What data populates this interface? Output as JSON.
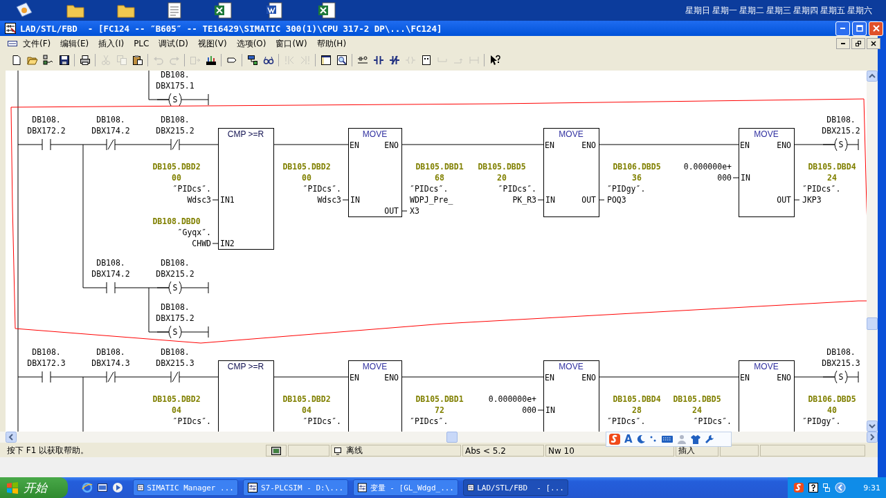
{
  "desktop": {
    "weekdays": [
      "星期日",
      "星期一",
      "星期二",
      "星期三",
      "星期四",
      "星期五",
      "星期六"
    ]
  },
  "window": {
    "title": "LAD/STL/FBD  - [FC124 -- ″B605″ -- TE16429\\SIMATIC 300(1)\\CPU 317-2 DP\\...\\FC124]"
  },
  "menu": [
    "文件(F)",
    "编辑(E)",
    "插入(I)",
    "PLC",
    "调试(D)",
    "视图(V)",
    "选项(O)",
    "窗口(W)",
    "帮助(H)"
  ],
  "toolbar": [
    {
      "kind": "button",
      "disabled": false
    },
    {
      "kind": "button",
      "disabled": false
    },
    {
      "kind": "button",
      "disabled": false
    },
    {
      "kind": "button",
      "disabled": false
    },
    {
      "kind": "separator"
    },
    {
      "kind": "button",
      "disabled": false
    },
    {
      "kind": "separator"
    },
    {
      "kind": "button",
      "disabled": true
    },
    {
      "kind": "button",
      "disabled": true
    },
    {
      "kind": "button",
      "disabled": false
    },
    {
      "kind": "separator"
    },
    {
      "kind": "button",
      "disabled": true
    },
    {
      "kind": "button",
      "disabled": true
    },
    {
      "kind": "separator"
    },
    {
      "kind": "button",
      "disabled": true
    },
    {
      "kind": "button",
      "disabled": false
    },
    {
      "kind": "separator"
    },
    {
      "kind": "button",
      "disabled": false
    },
    {
      "kind": "separator"
    },
    {
      "kind": "button",
      "disabled": false
    },
    {
      "kind": "button",
      "disabled": false
    },
    {
      "kind": "separator"
    },
    {
      "kind": "button",
      "disabled": true
    },
    {
      "kind": "button",
      "disabled": true
    },
    {
      "kind": "separator"
    },
    {
      "kind": "button",
      "disabled": false
    },
    {
      "kind": "button",
      "disabled": false
    },
    {
      "kind": "separator"
    },
    {
      "kind": "button",
      "disabled": false
    },
    {
      "kind": "button",
      "disabled": false
    },
    {
      "kind": "button",
      "disabled": false
    },
    {
      "kind": "button",
      "disabled": true
    },
    {
      "kind": "button",
      "disabled": false
    },
    {
      "kind": "button",
      "disabled": true
    },
    {
      "kind": "button",
      "disabled": true
    },
    {
      "kind": "button",
      "disabled": true
    },
    {
      "kind": "separator"
    },
    {
      "kind": "button",
      "disabled": false
    }
  ],
  "editor": {
    "networks": [
      {
        "kind": "tail",
        "coils": [
          {
            "type": "S",
            "address": [
              "DB108.",
              "DBX175.1"
            ]
          }
        ]
      },
      {
        "kind": "network",
        "contacts": [
          {
            "normally_closed": false,
            "address": [
              "DB108.",
              "DBX172.2"
            ]
          },
          {
            "normally_closed": true,
            "address": [
              "DB108.",
              "DBX174.2"
            ]
          },
          {
            "normally_closed": true,
            "address": [
              "DB108.",
              "DBX215.2"
            ]
          }
        ],
        "boxes": [
          {
            "kind": "compare",
            "title": "CMP >=R",
            "inputs": [
              {
                "pin": "IN1",
                "operand": {
                  "address": [
                    "DB105.DBD2",
                    "00"
                  ],
                  "symbol": [
                    "″PIDcs″.",
                    "Wdsc3"
                  ]
                }
              },
              {
                "pin": "IN2",
                "operand": {
                  "address": [
                    "DB108.DBD0"
                  ],
                  "symbol": [
                    "″Gyqx″.",
                    "CHWD"
                  ]
                }
              }
            ]
          },
          {
            "kind": "move",
            "title": "MOVE",
            "en": "EN",
            "eno": "ENO",
            "inputs": [
              {
                "pin": "IN",
                "operand": {
                  "address": [
                    "DB105.DBD2",
                    "00"
                  ],
                  "symbol": [
                    "″PIDcs″.",
                    "Wdsc3"
                  ]
                }
              }
            ],
            "outputs": [
              {
                "pin": "OUT",
                "operand": {
                  "address": [
                    "DB105.DBD1",
                    "68"
                  ],
                  "symbol": [
                    "″PIDcs″.",
                    "WDPJ_Pre_",
                    "X3"
                  ]
                }
              }
            ]
          },
          {
            "kind": "move",
            "title": "MOVE",
            "en": "EN",
            "eno": "ENO",
            "inputs": [
              {
                "pin": "IN",
                "operand": {
                  "address": [
                    "DB105.DBD5",
                    "20"
                  ],
                  "symbol": [
                    "″PIDcs″.",
                    "PK_R3"
                  ]
                }
              }
            ],
            "outputs": [
              {
                "pin": "OUT",
                "operand": {
                  "address": [
                    "DB106.DBD5",
                    "36"
                  ],
                  "symbol": [
                    "″PIDgy″.",
                    "POQ3"
                  ]
                }
              }
            ]
          },
          {
            "kind": "move",
            "title": "MOVE",
            "en": "EN",
            "eno": "ENO",
            "inputs": [
              {
                "pin": "IN",
                "operand": {
                  "value": [
                    "0.000000e+",
                    "000"
                  ]
                }
              }
            ],
            "outputs": [
              {
                "pin": "OUT",
                "operand": {
                  "address": [
                    "DB105.DBD4",
                    "24"
                  ],
                  "symbol": [
                    "″PIDcs″.",
                    "JKP3"
                  ]
                }
              }
            ]
          }
        ],
        "coil": {
          "type": "S",
          "address": [
            "DB108.",
            "DBX215.2"
          ]
        },
        "branch": {
          "contact": {
            "normally_closed": false,
            "address": [
              "DB108.",
              "DBX174.2"
            ]
          },
          "coils": [
            {
              "type": "S",
              "address": [
                "DB108.",
                "DBX215.2"
              ]
            },
            {
              "type": "S",
              "address": [
                "DB108.",
                "DBX175.2"
              ]
            }
          ]
        }
      },
      {
        "kind": "network",
        "contacts": [
          {
            "normally_closed": false,
            "address": [
              "DB108.",
              "DBX172.3"
            ]
          },
          {
            "normally_closed": true,
            "address": [
              "DB108.",
              "DBX174.3"
            ]
          },
          {
            "normally_closed": true,
            "address": [
              "DB108.",
              "DBX215.3"
            ]
          }
        ],
        "boxes": [
          {
            "kind": "compare",
            "title": "CMP >=R",
            "inputs": [
              {
                "operand": {
                  "address": [
                    "DB105.DBD2",
                    "04"
                  ],
                  "symbol": [
                    "″PIDcs″."
                  ]
                }
              }
            ]
          },
          {
            "kind": "move",
            "title": "MOVE",
            "en": "EN",
            "eno": "ENO",
            "inputs": [
              {
                "operand": {
                  "address": [
                    "DB105.DBD2",
                    "04"
                  ],
                  "symbol": [
                    "″PIDcs″."
                  ]
                }
              }
            ],
            "outputs": [
              {
                "operand": {
                  "address": [
                    "DB105.DBD1",
                    "72"
                  ],
                  "symbol": [
                    "″PIDcs″."
                  ]
                }
              }
            ]
          },
          {
            "kind": "move",
            "title": "MOVE",
            "en": "EN",
            "eno": "ENO",
            "inputs": [
              {
                "pin": "IN",
                "operand": {
                  "value": [
                    "0.000000e+",
                    "000"
                  ]
                }
              }
            ],
            "outputs": [
              {
                "operand": {
                  "address": [
                    "DB105.DBD4",
                    "28"
                  ],
                  "symbol": [
                    "″PIDcs″."
                  ]
                }
              }
            ]
          },
          {
            "kind": "move",
            "title": "MOVE",
            "en": "EN",
            "eno": "ENO",
            "inputs": [
              {
                "operand": {
                  "address": [
                    "DB105.DBD5",
                    "24"
                  ],
                  "symbol": [
                    "″PIDcs″."
                  ]
                }
              }
            ],
            "outputs": [
              {
                "operand": {
                  "address": [
                    "DB106.DBD5",
                    "40"
                  ],
                  "symbol": [
                    "″PIDgy″."
                  ]
                }
              }
            ]
          }
        ],
        "coil": {
          "type": "S",
          "address": [
            "DB108.",
            "DBX215.3"
          ]
        }
      }
    ]
  },
  "ime_toolbar": {
    "mode": "A"
  },
  "status_bar": {
    "help": "按下 F1 以获取帮助。",
    "mode": "离线",
    "address": "Abs < 5.2",
    "network": "Nw 10",
    "insert": "插入"
  },
  "taskbar": {
    "start": "开始",
    "tasks": [
      {
        "label": "SIMATIC Manager ...",
        "selected": false
      },
      {
        "label": "S7-PLCSIM - D:\\...",
        "selected": false
      },
      {
        "label": "变量 - [GL_Wdgd_...",
        "selected": false
      },
      {
        "label": "LAD/STL/FBD  - [...",
        "selected": true
      }
    ],
    "clock": "9:31"
  }
}
